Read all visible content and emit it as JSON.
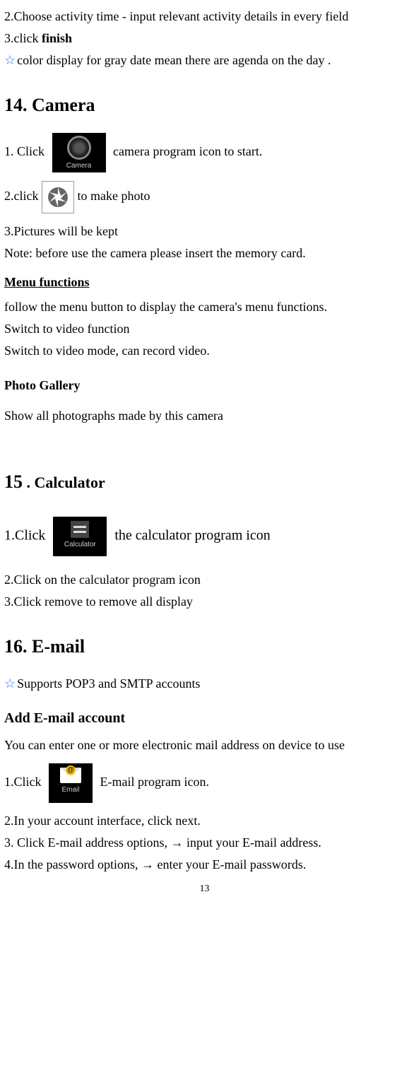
{
  "intro": {
    "line2": "2.Choose activity time -    input relevant activity details in every field",
    "line3_pre": "3.click ",
    "line3_bold": "finish",
    "star_note": "color display for gray date mean there are agenda on the day ."
  },
  "camera": {
    "heading": "14. Camera",
    "step1_pre": "1. Click  ",
    "step1_post": "  camera program icon to start.",
    "icon_label": "Camera",
    "step2_pre": "2.click   ",
    "step2_post": "to make photo",
    "step3": "3.Pictures will be kept",
    "note": "Note:    before    use the camera please insert the memory card.",
    "menu_heading": "Menu functions",
    "menu_p1": "follow the menu button to display the camera's menu functions.",
    "menu_p2": "Switch to video function",
    "menu_p3": "Switch to video mode, can record video.",
    "gallery_heading": "Photo Gallery",
    "gallery_p": "Show all photographs made by this camera"
  },
  "calculator": {
    "heading_num": "15",
    "heading_rest": " . Calculator",
    "step1_pre": "1.Click    ",
    "step1_post": "  the calculator program icon",
    "icon_label": "Calculator",
    "step2": "2.Click on    the calculator program icon",
    "step3": "3.Click remove to remove all display"
  },
  "email": {
    "heading": "16. E-mail",
    "star_note": "Supports POP3 and SMTP accounts",
    "add_heading": "Add E-mail account",
    "add_p": "You can enter one or more electronic mail address on device to use",
    "step1_pre": "1.Click  ",
    "step1_post": "  E-mail program icon.",
    "icon_label": "Email",
    "step2": "2.In your account interface, click next.",
    "step3": "3. Click E-mail address options, → input    your E-mail address.",
    "step4": "4.In the password options, → enter your E-mail passwords."
  },
  "page_number": "13"
}
